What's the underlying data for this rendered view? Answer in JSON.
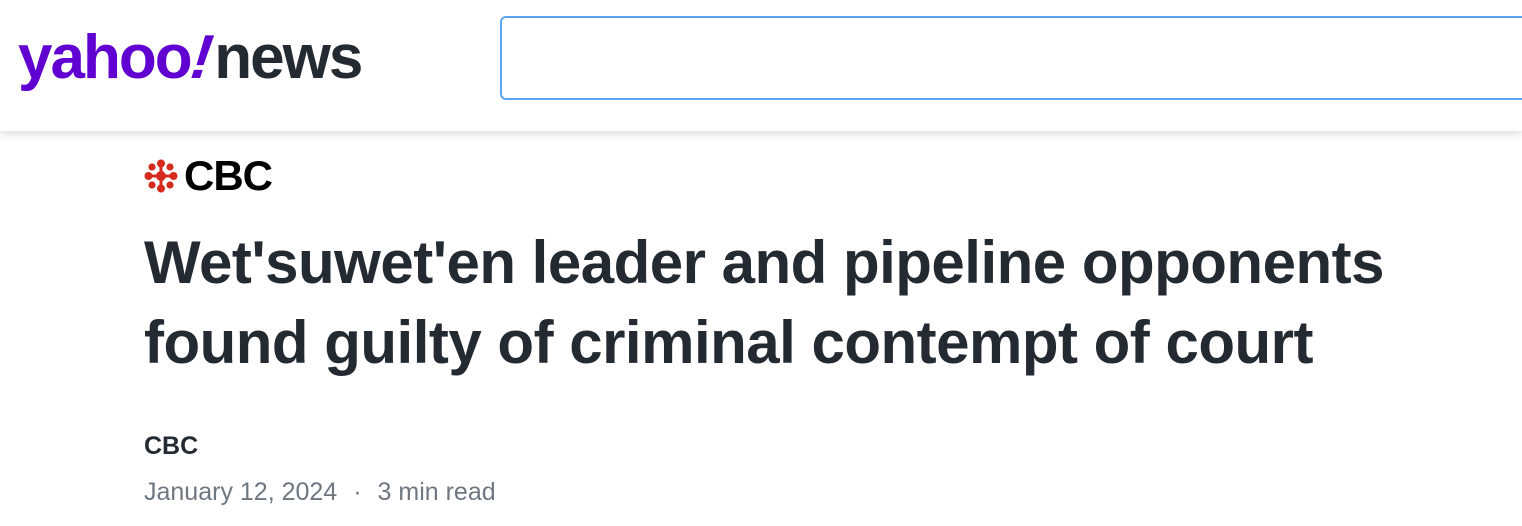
{
  "header": {
    "logo_yahoo": "yahoo",
    "logo_bang": "!",
    "logo_news": "news",
    "search_value": "",
    "search_placeholder": ""
  },
  "article": {
    "source_logo_text": "CBC",
    "headline_line1": "Wet'suwet'en leader and pipeline opponents",
    "headline_line2": "found guilty of criminal contempt of court",
    "byline": "CBC",
    "date": "January 12, 2024",
    "separator": "·",
    "read_time": "3 min read"
  },
  "colors": {
    "brand_purple": "#6001d2",
    "text_dark": "#232a31",
    "text_muted": "#6e7780",
    "search_border": "#5aa4f1",
    "cbc_red": "#d42b1e"
  },
  "icons": {
    "source_logo_icon": "cbc-gem-icon"
  }
}
